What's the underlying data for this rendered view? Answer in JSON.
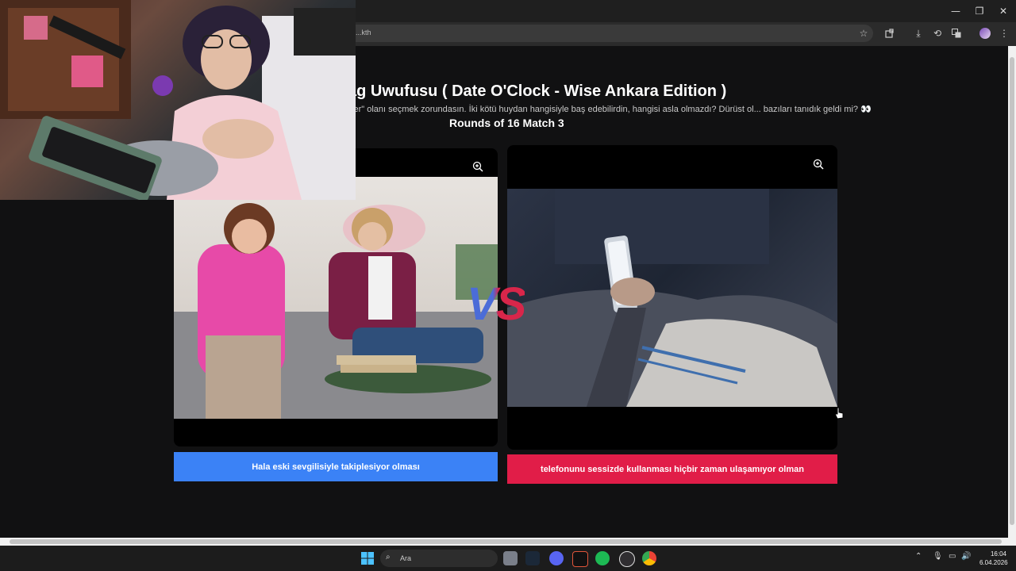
{
  "browser": {
    "url": "...kth",
    "window_buttons": {
      "minimize": "—",
      "restore": "❐",
      "close": "✕"
    },
    "toolbar_icons": [
      "star-icon",
      "extensions-icon",
      "download-icon",
      "history-icon",
      "translate-icon",
      "profile-icon",
      "menu-icon"
    ]
  },
  "page": {
    "title": "ag Uwufusu ( Date O'Clock - Wise Ankara Edition )",
    "description": "şer\" olanı seçmek zorundasın. İki kötü huydan hangisiyle baş edebilirdin, hangisi asla olmazdı? Dürüst ol... bazıları tanıdık geldi mi? 👀",
    "round": "Rounds of 16 Match 3",
    "vs_label": "VS",
    "left_choice": {
      "label": "Hala eski sevgilisiyle takiplesiyor olması",
      "color": "#3b82f6"
    },
    "right_choice": {
      "label": "telefonunu sessizde kullanması hiçbir zaman ulaşamıyor olman",
      "color": "#e11d48"
    }
  },
  "taskbar": {
    "search_placeholder": "Ara",
    "time": "16:04",
    "date": "6.04.2026",
    "apps": [
      "windows-start-icon",
      "file-explorer-icon",
      "steam-icon",
      "discord-icon",
      "media-app-icon",
      "spotify-icon",
      "obs-icon",
      "chrome-icon"
    ]
  }
}
